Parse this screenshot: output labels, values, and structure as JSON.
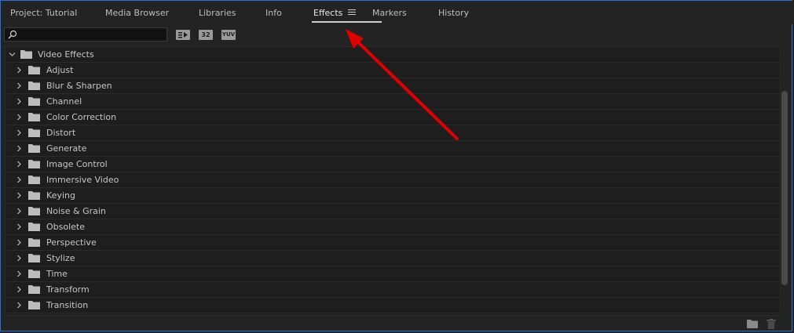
{
  "tabs": [
    {
      "label": "Project: Tutorial"
    },
    {
      "label": "Media Browser"
    },
    {
      "label": "Libraries"
    },
    {
      "label": "Info"
    },
    {
      "label": "Effects"
    },
    {
      "label": "Markers"
    },
    {
      "label": "History"
    }
  ],
  "active_tab": "Effects",
  "search": {
    "value": "",
    "placeholder": ""
  },
  "filter_buttons": [
    {
      "label": "32",
      "icon": "accelerated-effects-icon"
    },
    {
      "label": "32",
      "icon": "32bit-color-icon"
    },
    {
      "label": "YUV",
      "icon": "yuv-effects-icon"
    }
  ],
  "tree": {
    "root": {
      "label": "Video Effects",
      "expanded": true
    },
    "items": [
      {
        "label": "Adjust"
      },
      {
        "label": "Blur & Sharpen"
      },
      {
        "label": "Channel"
      },
      {
        "label": "Color Correction"
      },
      {
        "label": "Distort"
      },
      {
        "label": "Generate"
      },
      {
        "label": "Image Control"
      },
      {
        "label": "Immersive Video"
      },
      {
        "label": "Keying"
      },
      {
        "label": "Noise & Grain"
      },
      {
        "label": "Obsolete"
      },
      {
        "label": "Perspective"
      },
      {
        "label": "Stylize"
      },
      {
        "label": "Time"
      },
      {
        "label": "Transform"
      },
      {
        "label": "Transition"
      }
    ]
  },
  "colors": {
    "accent_border": "#2a6fd6",
    "arrow": "#e00000",
    "background": "#232323"
  }
}
